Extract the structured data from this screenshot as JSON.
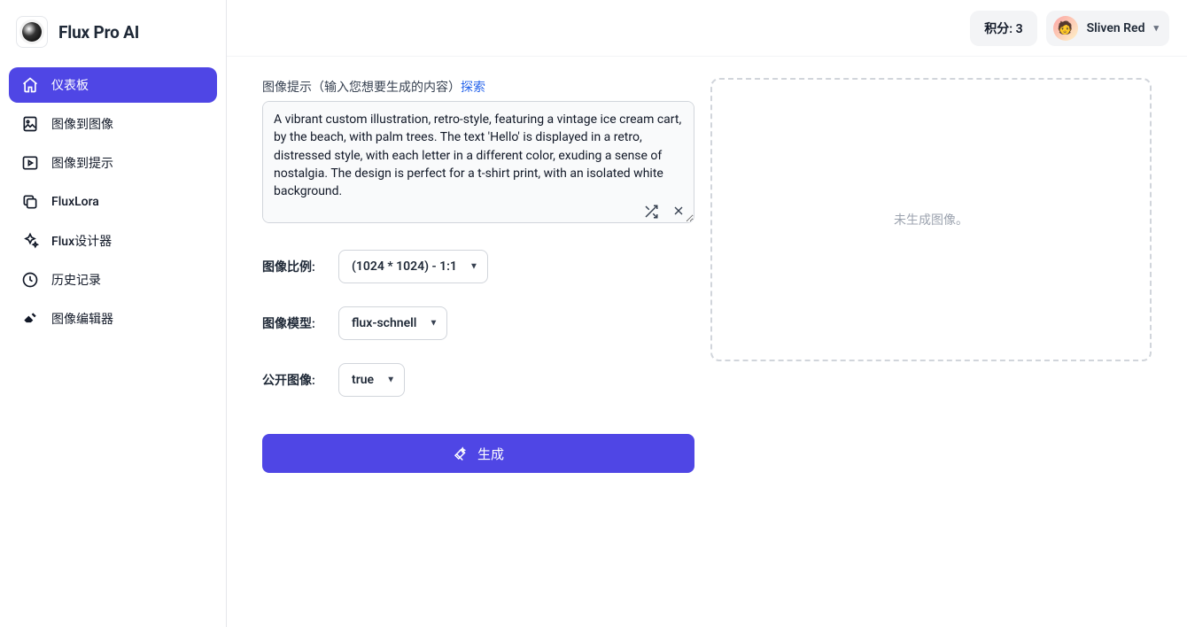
{
  "brand": {
    "name": "Flux Pro AI"
  },
  "sidebar": {
    "items": [
      {
        "label": "仪表板",
        "active": true,
        "icon": "home-icon"
      },
      {
        "label": "图像到图像",
        "active": false,
        "icon": "image-icon"
      },
      {
        "label": "图像到提示",
        "active": false,
        "icon": "play-square-icon"
      },
      {
        "label": "FluxLora",
        "active": false,
        "icon": "copy-icon"
      },
      {
        "label": "Flux设计器",
        "active": false,
        "icon": "sparkle-icon"
      },
      {
        "label": "历史记录",
        "active": false,
        "icon": "history-icon"
      },
      {
        "label": "图像编辑器",
        "active": false,
        "icon": "editor-icon"
      }
    ]
  },
  "header": {
    "credits_label": "积分: 3",
    "user_name": "Sliven Red"
  },
  "form": {
    "prompt_label_prefix": "图像提示（输入您想要生成的内容）",
    "prompt_explore": "探索",
    "prompt_value": "A vibrant custom illustration, retro-style, featuring a vintage ice cream cart, by the beach, with palm trees. The text 'Hello' is displayed in a retro, distressed style, with each letter in a different color, exuding a sense of nostalgia. The design is perfect for a t-shirt print, with an isolated white background.",
    "ratio_label": "图像比例:",
    "ratio_value": "(1024 * 1024) - 1:1",
    "model_label": "图像模型:",
    "model_value": "flux-schnell",
    "public_label": "公开图像:",
    "public_value": "true",
    "generate_label": "生成"
  },
  "preview": {
    "empty_text": "未生成图像。"
  }
}
